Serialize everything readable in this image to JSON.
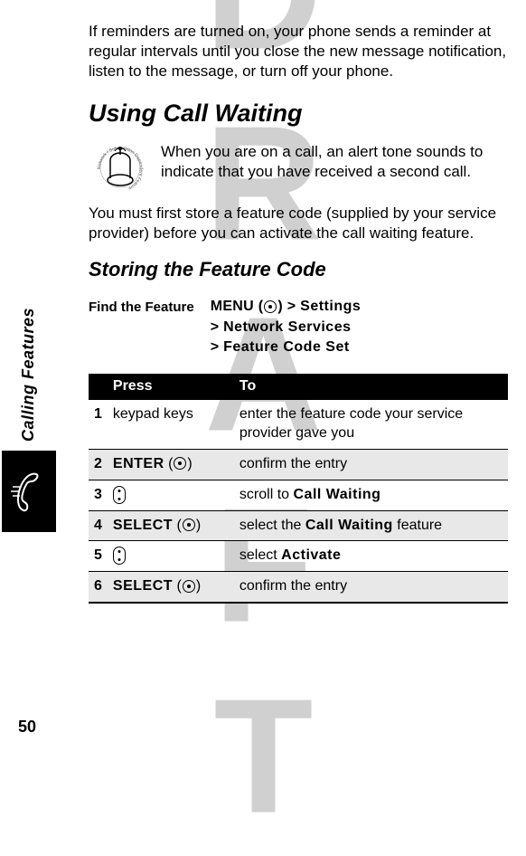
{
  "watermark": "DRAFT",
  "sidebar": {
    "label": "Calling Features"
  },
  "page_number": "50",
  "intro": "If reminders are turned on, your phone sends a reminder at regular intervals until you close the new message notification, listen to the message, or turn off your phone.",
  "heading": "Using Call Waiting",
  "para_icon": "When you are on a call, an alert tone sounds to indicate that you have received a second call.",
  "para_after": "You must first store a feature code (supplied by your service provider) before you can activate the call waiting feature.",
  "subheading": "Storing the Feature Code",
  "find_feature": {
    "label": "Find the Feature",
    "menu_word": "MENU",
    "gt": ">",
    "line1_suffix": "Settings",
    "line2": "Network Services",
    "line3": "Feature Code Set"
  },
  "table": {
    "headers": {
      "press": "Press",
      "to": "To"
    },
    "rows": [
      {
        "num": "1",
        "press_text": "keypad keys",
        "to_text": "enter the feature code your service provider gave you",
        "shaded": false,
        "key_type": "text"
      },
      {
        "num": "2",
        "press_label": "ENTER",
        "to_text": "confirm the entry",
        "shaded": true,
        "key_type": "softkey"
      },
      {
        "num": "3",
        "to_prefix": "scroll to ",
        "to_code": "Call Waiting",
        "shaded": false,
        "key_type": "scroll"
      },
      {
        "num": "4",
        "press_label": "SELECT",
        "to_prefix": "select the ",
        "to_code": "Call Waiting",
        "to_suffix": " feature",
        "shaded": true,
        "key_type": "softkey"
      },
      {
        "num": "5",
        "to_prefix": "select ",
        "to_code": "Activate",
        "shaded": false,
        "key_type": "scroll"
      },
      {
        "num": "6",
        "press_label": "SELECT",
        "to_text": "confirm the entry",
        "shaded": true,
        "key_type": "softkey"
      }
    ]
  }
}
